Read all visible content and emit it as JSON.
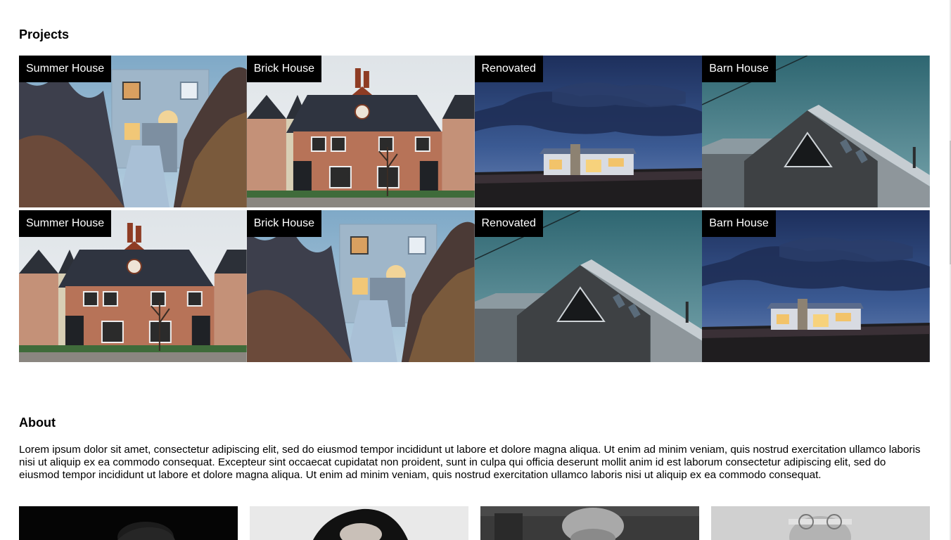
{
  "projects": {
    "title": "Projects",
    "items": [
      {
        "label": "Summer House",
        "scene": "summer"
      },
      {
        "label": "Brick House",
        "scene": "brick"
      },
      {
        "label": "Renovated",
        "scene": "renovated"
      },
      {
        "label": "Barn House",
        "scene": "barn"
      },
      {
        "label": "Summer House",
        "scene": "brick"
      },
      {
        "label": "Brick House",
        "scene": "summer"
      },
      {
        "label": "Renovated",
        "scene": "barn"
      },
      {
        "label": "Barn House",
        "scene": "renovated"
      }
    ]
  },
  "about": {
    "title": "About",
    "text": "Lorem ipsum dolor sit amet, consectetur adipiscing elit, sed do eiusmod tempor incididunt ut labore et dolore magna aliqua. Ut enim ad minim veniam, quis nostrud exercitation ullamco laboris nisi ut aliquip ex ea commodo consequat. Excepteur sint occaecat cupidatat non proident, sunt in culpa qui officia deserunt mollit anim id est laborum consectetur adipiscing elit, sed do eiusmod tempor incididunt ut labore et dolore magna aliqua. Ut enim ad minim veniam, quis nostrud exercitation ullamco laboris nisi ut aliquip ex ea commodo consequat."
  }
}
